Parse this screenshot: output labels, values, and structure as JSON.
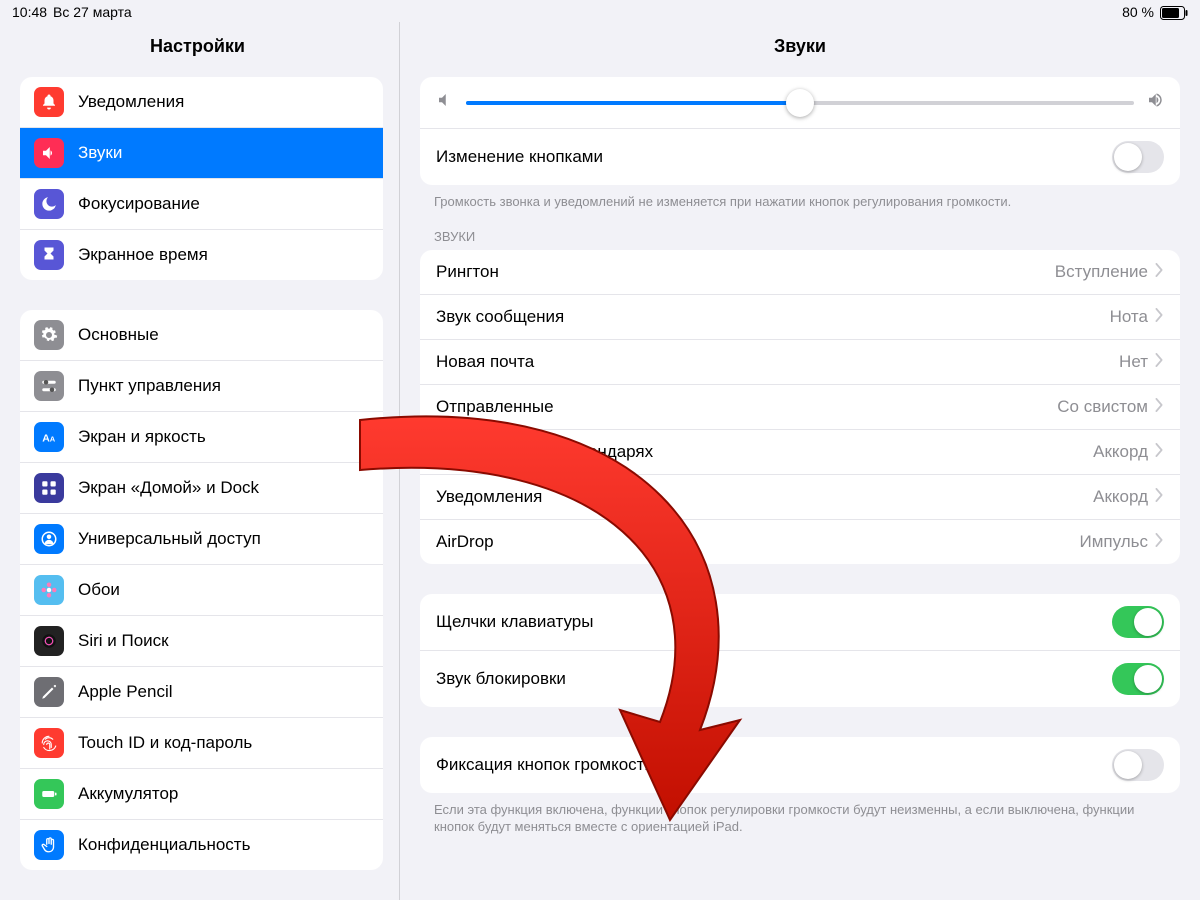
{
  "statusbar": {
    "time": "10:48",
    "date": "Вс 27 марта",
    "battery_pct": "80 %"
  },
  "sidebar": {
    "title": "Настройки",
    "groups": [
      {
        "items": [
          {
            "key": "notifications",
            "label": "Уведомления",
            "icon_bg": "#ff3b30",
            "icon": "bell"
          },
          {
            "key": "sounds",
            "label": "Звуки",
            "icon_bg": "#ff2d55",
            "icon": "speaker",
            "active": true
          },
          {
            "key": "focus",
            "label": "Фокусирование",
            "icon_bg": "#5856d6",
            "icon": "moon"
          },
          {
            "key": "screentime",
            "label": "Экранное время",
            "icon_bg": "#5856d6",
            "icon": "hourglass"
          }
        ]
      },
      {
        "items": [
          {
            "key": "general",
            "label": "Основные",
            "icon_bg": "#8e8e93",
            "icon": "gear"
          },
          {
            "key": "controlcenter",
            "label": "Пункт управления",
            "icon_bg": "#8e8e93",
            "icon": "switches"
          },
          {
            "key": "display",
            "label": "Экран и яркость",
            "icon_bg": "#007aff",
            "icon": "text-aa"
          },
          {
            "key": "homescreen",
            "label": "Экран «Домой» и Dock",
            "icon_bg": "#3a3a9d",
            "icon": "grid"
          },
          {
            "key": "accessibility",
            "label": "Универсальный доступ",
            "icon_bg": "#007aff",
            "icon": "person"
          },
          {
            "key": "wallpaper",
            "label": "Обои",
            "icon_bg": "#55bef0",
            "icon": "flower"
          },
          {
            "key": "siri",
            "label": "Siri и Поиск",
            "icon_bg": "#222",
            "icon": "siri"
          },
          {
            "key": "pencil",
            "label": "Apple Pencil",
            "icon_bg": "#6e6e73",
            "icon": "pencil"
          },
          {
            "key": "touchid",
            "label": "Touch ID и код-пароль",
            "icon_bg": "#ff3b30",
            "icon": "fingerprint"
          },
          {
            "key": "battery",
            "label": "Аккумулятор",
            "icon_bg": "#34c759",
            "icon": "battery"
          },
          {
            "key": "privacy",
            "label": "Конфиденциальность",
            "icon_bg": "#007aff",
            "icon": "hand"
          }
        ]
      }
    ]
  },
  "content": {
    "title": "Звуки",
    "volume": {
      "percent": 50
    },
    "change_with_buttons": {
      "label": "Изменение кнопками",
      "on": false
    },
    "change_note": "Громкость звонка и уведомлений не изменяется при нажатии кнопок регулирования громкости.",
    "sounds_header": "ЗВУКИ",
    "sound_picks": [
      {
        "key": "ringtone",
        "label": "Рингтон",
        "value": "Вступление"
      },
      {
        "key": "text",
        "label": "Звук сообщения",
        "value": "Нота"
      },
      {
        "key": "newmail",
        "label": "Новая почта",
        "value": "Нет"
      },
      {
        "key": "sentmail",
        "label": "Отправленные",
        "value": "Со свистом"
      },
      {
        "key": "calalerts",
        "label": "Уведомления в календарях",
        "value": "Аккорд"
      },
      {
        "key": "reminders",
        "label": "Уведомления",
        "value": "Аккорд"
      },
      {
        "key": "airdrop",
        "label": "AirDrop",
        "value": "Импульс"
      }
    ],
    "toggles": [
      {
        "key": "keyclicks",
        "label": "Щелчки клавиатуры",
        "on": true
      },
      {
        "key": "locksound",
        "label": "Звук блокировки",
        "on": true
      }
    ],
    "lock_orientation": {
      "label": "Фиксация кнопок громкости",
      "on": false
    },
    "lock_note": "Если эта функция включена, функции кнопок регулировки громкости будут неизменны, а если выключена, функции кнопок будут меняться вместе с ориентацией iPad."
  }
}
